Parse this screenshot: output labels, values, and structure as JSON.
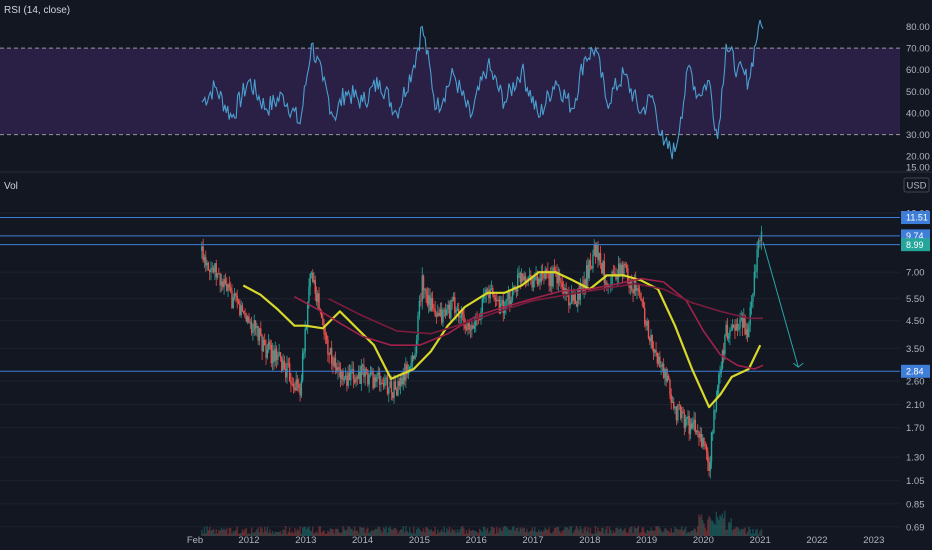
{
  "header": {
    "rsi_label": "RSI (14, close)",
    "vol_label": "Vol",
    "currency": "USD"
  },
  "colors": {
    "background": "#131722",
    "rsi_line": "#4a9fd0",
    "rsi_band": "#2a1f45",
    "ma_fast": "#d8d82a",
    "ma_slow": "#a0214a",
    "ma_slowest": "#7a1c3c",
    "level_line": "#3f7ed8",
    "candle_up": "#26a69a",
    "candle_down": "#ef5350",
    "projection_arrow": "#26a6a6"
  },
  "chart_data": [
    {
      "type": "line",
      "title": "RSI (14, close)",
      "y_ticks": [
        "15.00",
        "20.00",
        "30.00",
        "40.00",
        "50.00",
        "60.00",
        "70.00",
        "80.00"
      ],
      "ylim": [
        15,
        83
      ],
      "reference_levels": [
        30,
        70
      ],
      "series": [
        {
          "x": [
            2011.17,
            2011.4,
            2011.7,
            2012.0,
            2012.3,
            2012.6,
            2012.9,
            2013.1,
            2013.3,
            2013.5,
            2013.7,
            2014.0,
            2014.3,
            2014.6,
            2014.9,
            2015.05,
            2015.3,
            2015.6,
            2015.9,
            2016.2,
            2016.5,
            2016.8,
            2017.1,
            2017.4,
            2017.7,
            2017.9,
            2018.1,
            2018.3,
            2018.6,
            2018.9,
            2019.1,
            2019.3,
            2019.5,
            2019.6,
            2019.75,
            2019.9,
            2020.1,
            2020.25,
            2020.4,
            2020.6,
            2020.8,
            2020.97,
            2021.05
          ],
          "values": [
            45,
            52,
            38,
            55,
            42,
            48,
            35,
            72,
            55,
            38,
            50,
            45,
            55,
            40,
            62,
            80,
            42,
            58,
            38,
            62,
            45,
            60,
            38,
            55,
            42,
            65,
            70,
            45,
            58,
            40,
            48,
            25,
            22,
            38,
            62,
            48,
            55,
            28,
            72,
            60,
            55,
            80,
            79
          ]
        }
      ]
    },
    {
      "type": "line",
      "title": "Vol",
      "x_ticks": [
        "Feb",
        "2012",
        "2013",
        "2014",
        "2015",
        "2016",
        "2017",
        "2018",
        "2019",
        "2020",
        "2021",
        "2022",
        "2023"
      ],
      "y_ticks": [
        "0.69",
        "0.85",
        "1.05",
        "1.30",
        "1.70",
        "2.10",
        "2.60",
        "3.50",
        "4.50",
        "5.50",
        "7.00",
        "12.00"
      ],
      "y_scale": "log",
      "ylim": [
        0.67,
        13.5
      ],
      "axis_unit": "USD",
      "price_levels": [
        {
          "label": "11.51",
          "value": 11.51
        },
        {
          "label": "9.74",
          "value": 9.74
        },
        {
          "label": "8.99",
          "value": 8.99
        },
        {
          "label": "2.84",
          "value": 2.84
        }
      ],
      "series": [
        {
          "x": [
            2011.17,
            2011.4,
            2011.7,
            2012.0,
            2012.3,
            2012.6,
            2012.9,
            2013.1,
            2013.3,
            2013.5,
            2013.7,
            2014.0,
            2014.3,
            2014.6,
            2014.9,
            2015.05,
            2015.3,
            2015.6,
            2015.9,
            2016.2,
            2016.5,
            2016.8,
            2017.1,
            2017.4,
            2017.7,
            2017.9,
            2018.1,
            2018.3,
            2018.6,
            2018.9,
            2019.1,
            2019.3,
            2019.5,
            2019.6,
            2019.75,
            2019.9,
            2020.1,
            2020.25,
            2020.4,
            2020.6,
            2020.8,
            2020.97,
            2021.05
          ],
          "values": [
            8.5,
            7.0,
            5.5,
            4.5,
            3.5,
            3.0,
            2.4,
            7.5,
            4.2,
            3.0,
            2.6,
            2.8,
            2.6,
            2.4,
            3.2,
            6.5,
            4.5,
            5.2,
            4.0,
            6.0,
            5.0,
            7.0,
            6.5,
            6.8,
            5.2,
            6.5,
            8.8,
            6.5,
            7.2,
            5.5,
            3.5,
            2.8,
            2.0,
            1.9,
            1.75,
            1.65,
            1.2,
            2.6,
            4.0,
            4.5,
            4.2,
            9.8,
            9.2
          ]
        },
        {
          "x": [
            2011.9,
            2012.2,
            2012.5,
            2012.8,
            2013.0,
            2013.3,
            2013.6,
            2013.9,
            2014.2,
            2014.5,
            2014.9,
            2015.2,
            2015.5,
            2015.8,
            2016.2,
            2016.5,
            2016.8,
            2017.1,
            2017.4,
            2017.7,
            2018.0,
            2018.3,
            2018.6,
            2018.9,
            2019.2,
            2019.5,
            2019.8,
            2020.1,
            2020.3,
            2020.5,
            2020.8,
            2021.0
          ],
          "values": [
            6.2,
            5.7,
            5.0,
            4.3,
            4.3,
            4.2,
            4.9,
            4.2,
            3.6,
            2.65,
            2.9,
            3.4,
            4.3,
            5.1,
            5.8,
            5.8,
            6.2,
            7.0,
            7.0,
            6.5,
            6.0,
            6.8,
            6.8,
            6.5,
            6.0,
            4.3,
            2.9,
            2.05,
            2.3,
            2.7,
            2.9,
            3.6
          ]
        },
        {
          "x": [
            2012.8,
            2013.2,
            2013.6,
            2014.0,
            2014.5,
            2015.0,
            2015.5,
            2016.0,
            2016.5,
            2017.0,
            2017.5,
            2018.0,
            2018.5,
            2018.9,
            2019.3,
            2019.7,
            2020.0,
            2020.3,
            2020.6,
            2020.9,
            2021.05
          ],
          "values": [
            5.6,
            5.0,
            4.4,
            3.9,
            3.6,
            3.6,
            4.0,
            4.7,
            5.1,
            5.5,
            5.9,
            6.0,
            6.3,
            6.6,
            6.4,
            5.4,
            4.1,
            3.3,
            3.0,
            2.9,
            3.0
          ]
        },
        {
          "x": [
            2013.4,
            2014.0,
            2014.6,
            2015.2,
            2015.8,
            2016.4,
            2017.0,
            2017.6,
            2018.2,
            2018.8,
            2019.3,
            2019.8,
            2020.3,
            2020.8,
            2021.05
          ],
          "values": [
            5.5,
            4.7,
            4.1,
            4.0,
            4.4,
            4.9,
            5.4,
            5.7,
            6.0,
            6.3,
            6.0,
            5.3,
            4.9,
            4.6,
            4.6
          ]
        },
        {
          "x": [
            2021.05,
            2021.67
          ],
          "values": [
            9.2,
            2.95
          ]
        }
      ]
    }
  ]
}
